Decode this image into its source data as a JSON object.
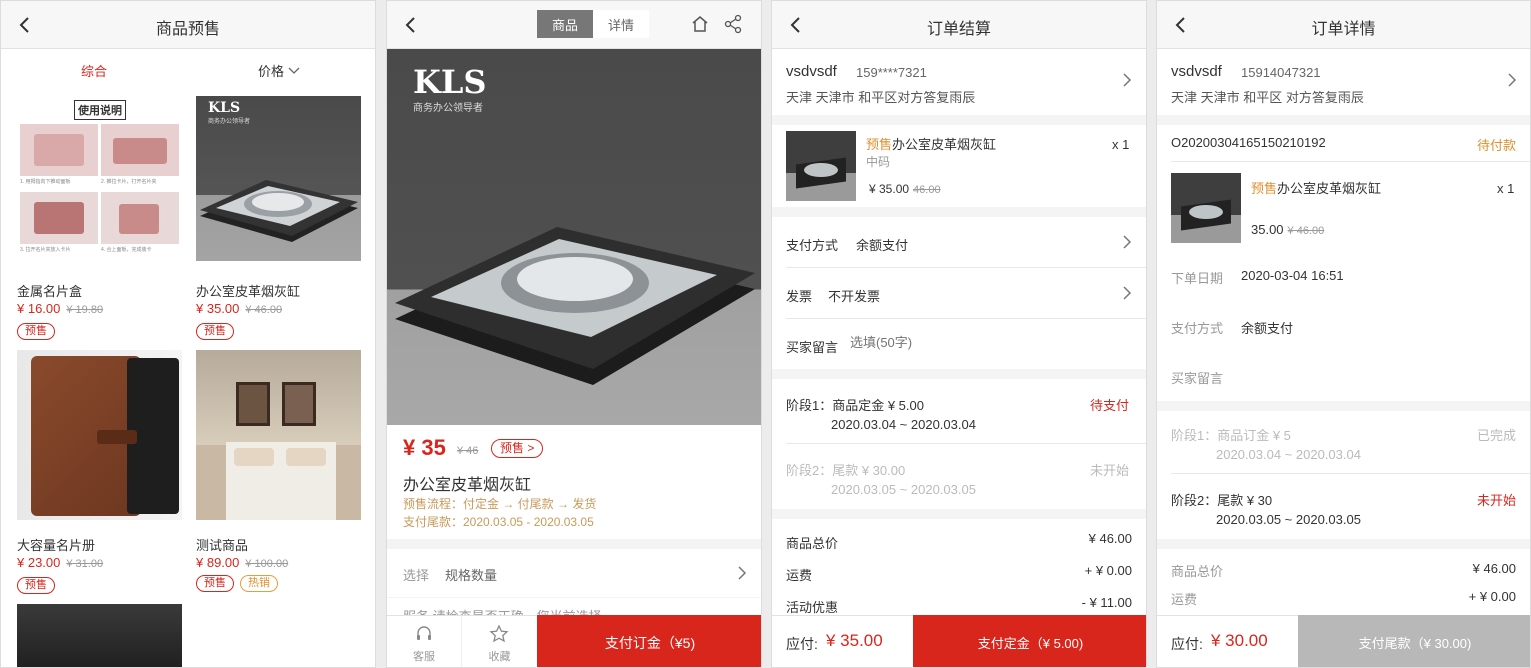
{
  "s1": {
    "title": "商品预售",
    "sort_all": "综合",
    "sort_price": "价格",
    "guide_label": "使用说明",
    "guide_caps": [
      "1. 用拇指向下推动面板",
      "2. 推拉卡片，打开名片夹",
      "3. 拉开名片夹放入卡片",
      "4. 合上面板，完成装卡"
    ],
    "logo_kls": "KLS",
    "logo_sub": "商务办公领导者",
    "products": [
      {
        "name": "金属名片盒",
        "price": "¥ 16.00",
        "orig": "¥ 19.80",
        "tags": [
          "预售"
        ]
      },
      {
        "name": "办公室皮革烟灰缸",
        "price": "¥ 35.00",
        "orig": "¥ 46.00",
        "tags": [
          "预售"
        ]
      },
      {
        "name": "大容量名片册",
        "price": "¥ 23.00",
        "orig": "¥ 31.00",
        "tags": [
          "预售"
        ]
      },
      {
        "name": "测试商品",
        "price": "¥ 89.00",
        "orig": "¥ 100.00",
        "tags": [
          "预售",
          "热销"
        ]
      }
    ]
  },
  "s2": {
    "tab_goods": "商品",
    "tab_detail": "详情",
    "logo_kls": "KLS",
    "logo_sub": "商务办公领导者",
    "price": "¥ 35",
    "orig": "¥ 46",
    "presale_tag": "预售 >",
    "name": "办公室皮革烟灰缸",
    "flow": "预售流程：付定金 → 付尾款 → 发货",
    "tail": "支付尾款：2020.03.05 - 2020.03.05",
    "select_label": "选择",
    "select_val": "规格数量",
    "partial": "服务  请检查是否正确，您当前选择...",
    "service": "客服",
    "fav": "收藏",
    "pay_btn": "支付订金（¥5)"
  },
  "s3": {
    "title": "订单结算",
    "user": "vsdvsdf",
    "phone": "159****7321",
    "addr": "天津 天津市 和平区对方答复雨辰",
    "item_tag": "预售",
    "item_name": "办公室皮革烟灰缸",
    "item_spec": "中码",
    "item_qty": "x 1",
    "item_price": "¥ 35.00",
    "item_orig": "46.00",
    "pay_label": "支付方式",
    "pay_val": "余额支付",
    "invoice_label": "发票",
    "invoice_val": "不开发票",
    "msg_label": "买家留言",
    "msg_ph": "选填(50字)",
    "st1": "阶段1：商品定金 ¥ 5.00",
    "st1_status": "待支付",
    "st1_date": "2020.03.04 ~ 2020.03.04",
    "st2": "阶段2：尾款 ¥ 30.00",
    "st2_status": "未开始",
    "st2_date": "2020.03.05 ~ 2020.03.05",
    "total_label": "商品总价",
    "total_val": "¥ 46.00",
    "ship_label": "运费",
    "ship_val": "+ ¥ 0.00",
    "disc_label": "活动优惠",
    "disc_val": "- ¥ 11.00",
    "due_label": "应付:",
    "due_val": "¥ 35.00",
    "btn": "支付定金（¥ 5.00)"
  },
  "s4": {
    "title": "订单详情",
    "user": "vsdvsdf",
    "phone": "15914047321",
    "addr": "天津 天津市 和平区 对方答复雨辰",
    "order_no": "O20200304165150210192",
    "order_status": "待付款",
    "item_tag": "预售",
    "item_name": "办公室皮革烟灰缸",
    "item_qty": "x 1",
    "item_price": "35.00",
    "item_orig": "¥ 46.00",
    "date_label": "下单日期",
    "date_val": "2020-03-04 16:51",
    "pay_label": "支付方式",
    "pay_val": "余额支付",
    "msg_label": "买家留言",
    "st1": "阶段1：商品订金 ¥ 5",
    "st1_status": "已完成",
    "st1_date": "2020.03.04 ~ 2020.03.04",
    "st2": "阶段2：尾款 ¥ 30",
    "st2_status": "未开始",
    "st2_date": "2020.03.05 ~ 2020.03.05",
    "total_label": "商品总价",
    "total_val": "¥ 46.00",
    "ship_label": "运费",
    "ship_val": "+ ¥ 0.00",
    "due_label": "应付:",
    "due_val": "¥ 30.00",
    "btn": "支付尾款（¥ 30.00)"
  },
  "colors": {
    "red": "#d9261c",
    "orange": "#e0902f",
    "disabled": "#b8b8b8"
  }
}
